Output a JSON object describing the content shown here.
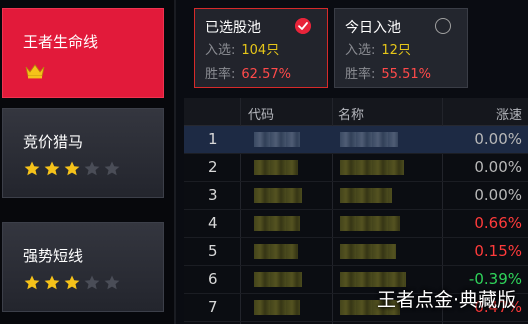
{
  "strategies": [
    {
      "label": "王者生命线",
      "indicator": "crown-icon",
      "active": true
    },
    {
      "label": "竞价猎马",
      "stars_filled": 3,
      "stars_total": 5,
      "active": false
    },
    {
      "label": "强势短线",
      "stars_filled": 3,
      "stars_total": 5,
      "active": false
    }
  ],
  "pools": [
    {
      "title": "已选股池",
      "checked": true,
      "selected_label": "入选:",
      "selected_value": "104只",
      "winrate_label": "胜率:",
      "winrate_value": "62.57%"
    },
    {
      "title": "今日入池",
      "checked": false,
      "selected_label": "入选:",
      "selected_value": "12只",
      "winrate_label": "胜率:",
      "winrate_value": "55.51%"
    }
  ],
  "table": {
    "headers": {
      "code": "代码",
      "name": "名称",
      "change": "涨速"
    },
    "rows": [
      {
        "index": "1",
        "change": "0.00%",
        "trend": "flat"
      },
      {
        "index": "2",
        "change": "0.00%",
        "trend": "flat"
      },
      {
        "index": "3",
        "change": "0.00%",
        "trend": "flat"
      },
      {
        "index": "4",
        "change": "0.66%",
        "trend": "up"
      },
      {
        "index": "5",
        "change": "0.15%",
        "trend": "up"
      },
      {
        "index": "6",
        "change": "-0.39%",
        "trend": "down"
      },
      {
        "index": "7",
        "change": "0.47%",
        "trend": "up"
      }
    ]
  },
  "watermark": "王者点金·典藏版",
  "colors": {
    "accent_red": "#e21a3a",
    "up": "#ff3b3b",
    "down": "#2fd35a",
    "highlight": "#e6c619"
  }
}
